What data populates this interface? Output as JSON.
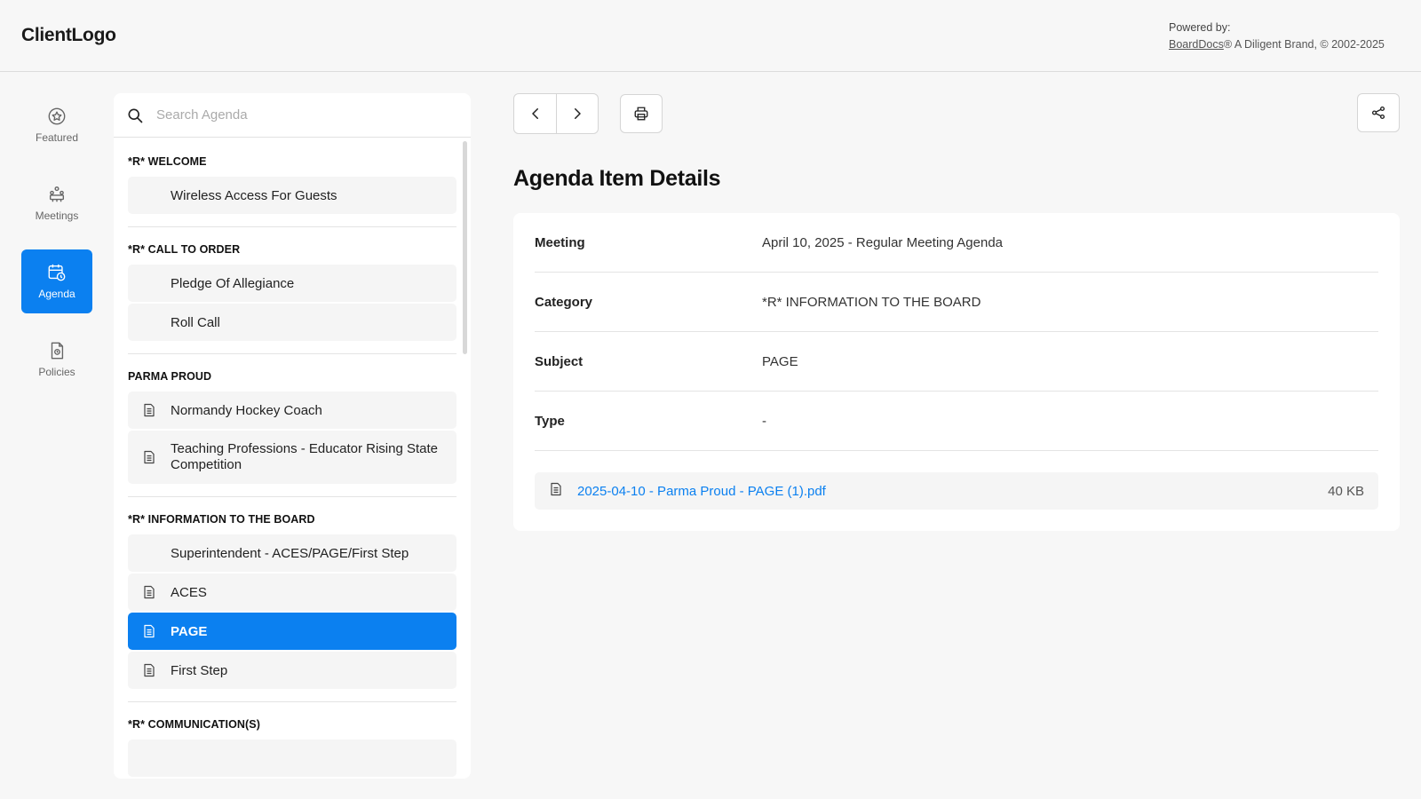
{
  "header": {
    "logo": "ClientLogo",
    "powered_by": "Powered by:",
    "brand_link": "BoardDocs",
    "brand_tail": "® A Diligent Brand, © 2002-2025"
  },
  "sidenav": {
    "items": [
      {
        "label": "Featured",
        "icon": "star-badge-icon",
        "active": false
      },
      {
        "label": "Meetings",
        "icon": "meeting-icon",
        "active": false
      },
      {
        "label": "Agenda",
        "icon": "calendar-clock-icon",
        "active": true
      },
      {
        "label": "Policies",
        "icon": "policy-document-icon",
        "active": false
      }
    ]
  },
  "search": {
    "placeholder": "Search Agenda",
    "value": ""
  },
  "agenda": {
    "sections": [
      {
        "title": "*R* WELCOME",
        "items": [
          {
            "label": "Wireless Access For Guests",
            "has_doc": false
          }
        ]
      },
      {
        "title": "*R* CALL TO ORDER",
        "items": [
          {
            "label": "Pledge Of Allegiance",
            "has_doc": false
          },
          {
            "label": "Roll Call",
            "has_doc": false
          }
        ]
      },
      {
        "title": "PARMA PROUD",
        "items": [
          {
            "label": "Normandy Hockey Coach",
            "has_doc": true
          },
          {
            "label": "Teaching Professions - Educator Rising State Competition",
            "has_doc": true
          }
        ]
      },
      {
        "title": "*R* INFORMATION TO THE BOARD",
        "items": [
          {
            "label": "Superintendent - ACES/PAGE/First Step",
            "has_doc": false
          },
          {
            "label": "ACES",
            "has_doc": true
          },
          {
            "label": "PAGE",
            "has_doc": true,
            "active": true
          },
          {
            "label": "First Step",
            "has_doc": true
          }
        ]
      },
      {
        "title": "*R* COMMUNICATION(S)",
        "items": []
      }
    ]
  },
  "main": {
    "title": "Agenda Item Details",
    "details": [
      {
        "key": "Meeting",
        "value": "April 10, 2025 - Regular Meeting Agenda"
      },
      {
        "key": "Category",
        "value": "*R* INFORMATION TO THE BOARD"
      },
      {
        "key": "Subject",
        "value": "PAGE"
      },
      {
        "key": "Type",
        "value": "-"
      }
    ],
    "attachment": {
      "filename": "2025-04-10 - Parma Proud - PAGE (1).pdf",
      "size": "40 KB"
    }
  },
  "colors": {
    "accent": "#0b80f0",
    "background": "#f7f7f7"
  }
}
